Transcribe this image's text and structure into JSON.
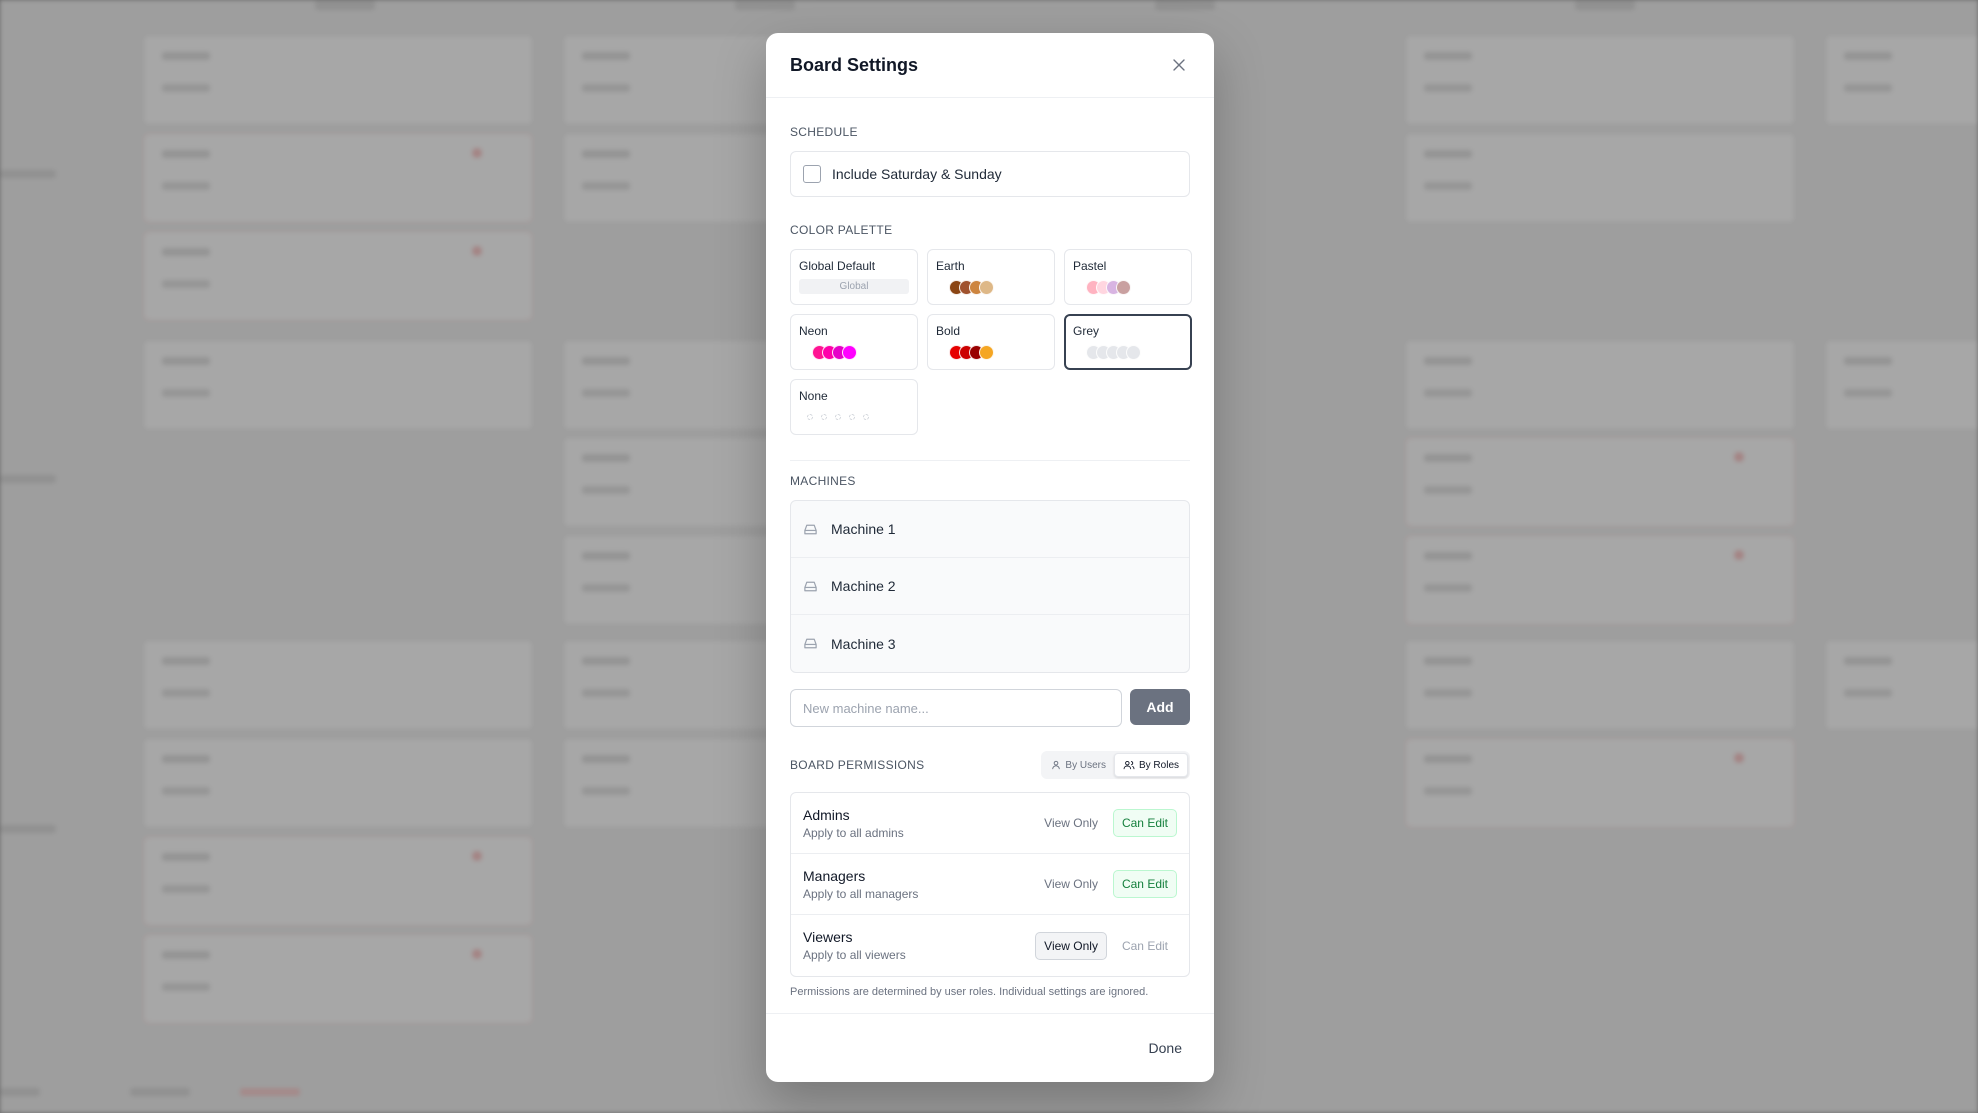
{
  "modal": {
    "title": "Board Settings"
  },
  "schedule": {
    "label": "SCHEDULE",
    "weekend_label": "Include Saturday & Sunday",
    "weekend_checked": false
  },
  "palette": {
    "label": "COLOR PALETTE",
    "selected": "Grey",
    "options": [
      {
        "name": "Global Default",
        "pill": "Global",
        "colors": []
      },
      {
        "name": "Earth",
        "colors": [
          "#8b4513",
          "#a0522d",
          "#cd853f",
          "#deb887"
        ]
      },
      {
        "name": "Pastel",
        "colors": [
          "#ffb3c1",
          "#ffd6e0",
          "#d8b4e2",
          "#c9a0a0"
        ]
      },
      {
        "name": "Neon",
        "colors": [
          "#ff1493",
          "#ff00aa",
          "#e600c8",
          "#ff00ff"
        ]
      },
      {
        "name": "Bold",
        "colors": [
          "#e60000",
          "#cc0000",
          "#990000",
          "#f5a623"
        ]
      },
      {
        "name": "Grey",
        "colors": [
          "#e5e7eb",
          "#e5e7eb",
          "#e5e7eb",
          "#e5e7eb",
          "#e5e7eb"
        ]
      },
      {
        "name": "None",
        "colors": []
      }
    ]
  },
  "machines": {
    "label": "MACHINES",
    "items": [
      {
        "name": "Machine 1"
      },
      {
        "name": "Machine 2"
      },
      {
        "name": "Machine 3"
      }
    ],
    "input_placeholder": "New machine name...",
    "add_label": "Add"
  },
  "permissions": {
    "label": "BOARD PERMISSIONS",
    "toggle_users": "By Users",
    "toggle_roles": "By Roles",
    "active_toggle": "By Roles",
    "view_label": "View Only",
    "edit_label": "Can Edit",
    "roles": [
      {
        "name": "Admins",
        "desc": "Apply to all admins",
        "access": "edit"
      },
      {
        "name": "Managers",
        "desc": "Apply to all managers",
        "access": "edit"
      },
      {
        "name": "Viewers",
        "desc": "Apply to all viewers",
        "access": "view"
      }
    ],
    "note": "Permissions are determined by user roles. Individual settings are ignored."
  },
  "footer": {
    "done_label": "Done"
  },
  "colors": {
    "accent_dark": "#374151",
    "edit_green": "#15803d",
    "add_button": "#6b7280"
  }
}
